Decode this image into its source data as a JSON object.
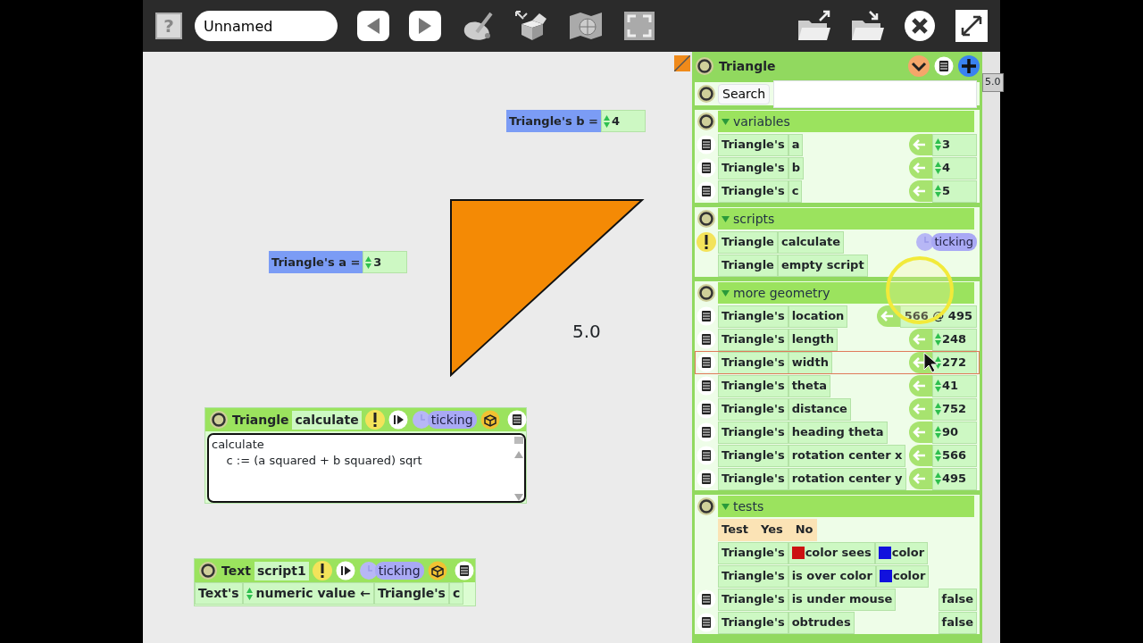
{
  "toolbar": {
    "help_label": "?",
    "project_name": "Unnamed"
  },
  "world": {
    "watchers": [
      {
        "label": "Triangle's b =",
        "value": "4"
      },
      {
        "label": "Triangle's a =",
        "value": "3"
      }
    ],
    "readout": "5.0",
    "scripts": [
      {
        "kind": "textual",
        "object": "Triangle",
        "name": "calculate",
        "status": "ticking",
        "code": [
          "calculate",
          "    c := (a squared + b squared) sqrt"
        ]
      },
      {
        "kind": "tiles",
        "object": "Text",
        "name": "script1",
        "status": "ticking",
        "tiles": {
          "target": "Text's",
          "slot": "numeric value",
          "operator": "←",
          "source": "Triangle's",
          "source_slot": "c"
        }
      }
    ]
  },
  "viewer": {
    "title": "Triangle",
    "search_label": "Search",
    "side_tab": "5.0",
    "categories": [
      {
        "name": "variables",
        "expanded": true,
        "rows": [
          {
            "kind": "slot",
            "object": "Triangle's",
            "slot": "a",
            "value": "3",
            "stepper": true,
            "selected": false
          },
          {
            "kind": "slot",
            "object": "Triangle's",
            "slot": "b",
            "value": "4",
            "stepper": true,
            "selected": false
          },
          {
            "kind": "slot",
            "object": "Triangle's",
            "slot": "c",
            "value": "5",
            "stepper": true,
            "selected": false
          }
        ]
      },
      {
        "name": "scripts",
        "expanded": true,
        "rows": [
          {
            "kind": "script",
            "object": "Triangle",
            "name": "calculate",
            "warning": true,
            "status": "ticking"
          },
          {
            "kind": "script",
            "object": "Triangle",
            "name": "empty script",
            "warning": false
          }
        ]
      },
      {
        "name": "more geometry",
        "expanded": true,
        "rows": [
          {
            "kind": "slot",
            "object": "Triangle's",
            "slot": "location",
            "value": "566 @ 495",
            "stepper": false,
            "selected": false
          },
          {
            "kind": "slot",
            "object": "Triangle's",
            "slot": "length",
            "value": "248",
            "stepper": true,
            "selected": false
          },
          {
            "kind": "slot",
            "object": "Triangle's",
            "slot": "width",
            "value": "272",
            "stepper": true,
            "selected": true
          },
          {
            "kind": "slot",
            "object": "Triangle's",
            "slot": "theta",
            "value": "41",
            "stepper": true,
            "selected": false
          },
          {
            "kind": "slot",
            "object": "Triangle's",
            "slot": "distance",
            "value": "752",
            "stepper": true,
            "selected": false
          },
          {
            "kind": "slot",
            "object": "Triangle's",
            "slot": "heading theta",
            "value": "90",
            "stepper": true,
            "selected": false
          },
          {
            "kind": "slot",
            "object": "Triangle's",
            "slot": "rotation center x",
            "value": "566",
            "stepper": true,
            "selected": false
          },
          {
            "kind": "slot",
            "object": "Triangle's",
            "slot": "rotation center y",
            "value": "495",
            "stepper": true,
            "selected": false
          }
        ]
      },
      {
        "name": "tests",
        "expanded": true,
        "rows": [
          {
            "kind": "test",
            "words": [
              "Test",
              "Yes",
              "No"
            ]
          },
          {
            "kind": "phrase",
            "object": "Triangle's",
            "parts": [
              {
                "text": "color sees",
                "color": "#cc1111"
              },
              {
                "text": "color",
                "color": "#1111dd"
              }
            ]
          },
          {
            "kind": "phrase",
            "object": "Triangle's",
            "parts": [
              {
                "text": "is over color"
              },
              {
                "text": "color",
                "color": "#1111dd"
              }
            ]
          },
          {
            "kind": "readout",
            "object": "Triangle's",
            "slot": "is under mouse",
            "value": "false"
          },
          {
            "kind": "readout",
            "object": "Triangle's",
            "slot": "obtrudes",
            "value": "false"
          }
        ]
      }
    ]
  }
}
